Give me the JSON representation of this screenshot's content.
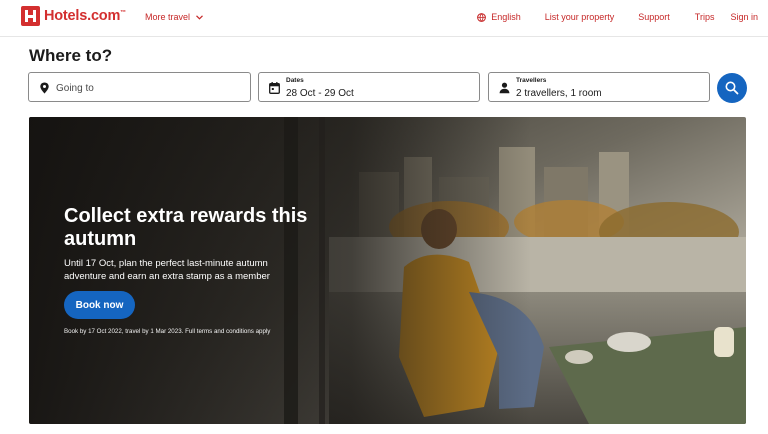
{
  "header": {
    "brand": "Hotels.com",
    "brand_tm": "™",
    "more_travel": "More travel",
    "language": "English",
    "list_property": "List your property",
    "support": "Support",
    "trips": "Trips",
    "sign_in": "Sign in"
  },
  "search": {
    "title": "Where to?",
    "going_to_placeholder": "Going to",
    "dates_label": "Dates",
    "dates_value": "28 Oct - 29 Oct",
    "travellers_label": "Travellers",
    "travellers_value": "2 travellers, 1 room"
  },
  "hero": {
    "title": "Collect extra rewards this autumn",
    "description": "Until 17 Oct, plan the perfect last-minute autumn adventure and earn an extra stamp as a member",
    "cta": "Book now",
    "terms": "Book by 17 Oct 2022, travel by 1 Mar 2023. Full terms and conditions apply"
  },
  "colors": {
    "brand_red": "#d32f2f",
    "link_red": "#c62828",
    "primary_blue": "#1565c0"
  },
  "icons": [
    "hotels-logo-icon",
    "chevron-down-icon",
    "globe-icon",
    "location-pin-icon",
    "calendar-icon",
    "person-icon",
    "search-icon"
  ]
}
